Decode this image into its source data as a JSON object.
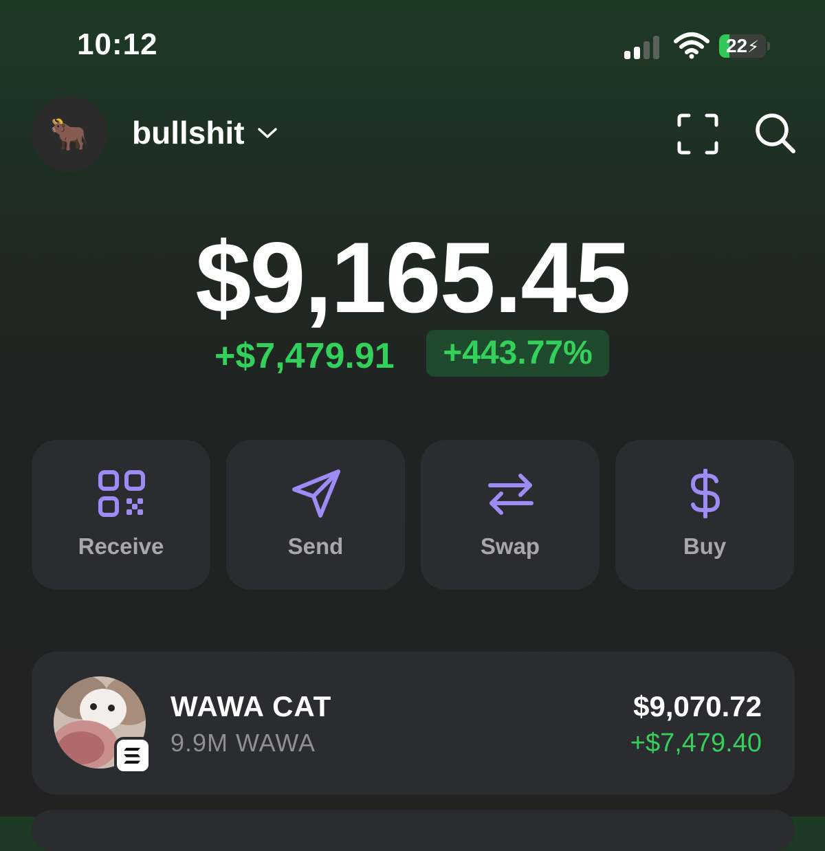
{
  "status_bar": {
    "time": "10:12",
    "battery_level": "22",
    "battery_fill_fraction": 0.22,
    "signal_icon": "cellular-signal-icon",
    "wifi_icon": "wifi-icon",
    "charging_icon": "bolt-icon"
  },
  "header": {
    "avatar_emoji": "🐂",
    "account_name": "bullshit",
    "dropdown_icon": "chevron-down-icon",
    "scan_icon": "scan-icon",
    "search_icon": "search-icon"
  },
  "balance": {
    "total": "$9,165.45",
    "change_amount": "+$7,479.91",
    "change_percent": "+443.77%"
  },
  "actions": [
    {
      "label": "Receive",
      "icon": "qr-code-icon"
    },
    {
      "label": "Send",
      "icon": "send-icon"
    },
    {
      "label": "Swap",
      "icon": "swap-icon"
    },
    {
      "label": "Buy",
      "icon": "dollar-icon"
    }
  ],
  "tokens": [
    {
      "name": "WAWA CAT",
      "quantity": "9.9M WAWA",
      "value": "$9,070.72",
      "change": "+$7,479.40",
      "chain_icon": "solana-icon"
    }
  ],
  "colors": {
    "accent_purple": "#9d8cf5",
    "positive_green": "#34d05c",
    "card_bg": "#2b2c2f"
  }
}
